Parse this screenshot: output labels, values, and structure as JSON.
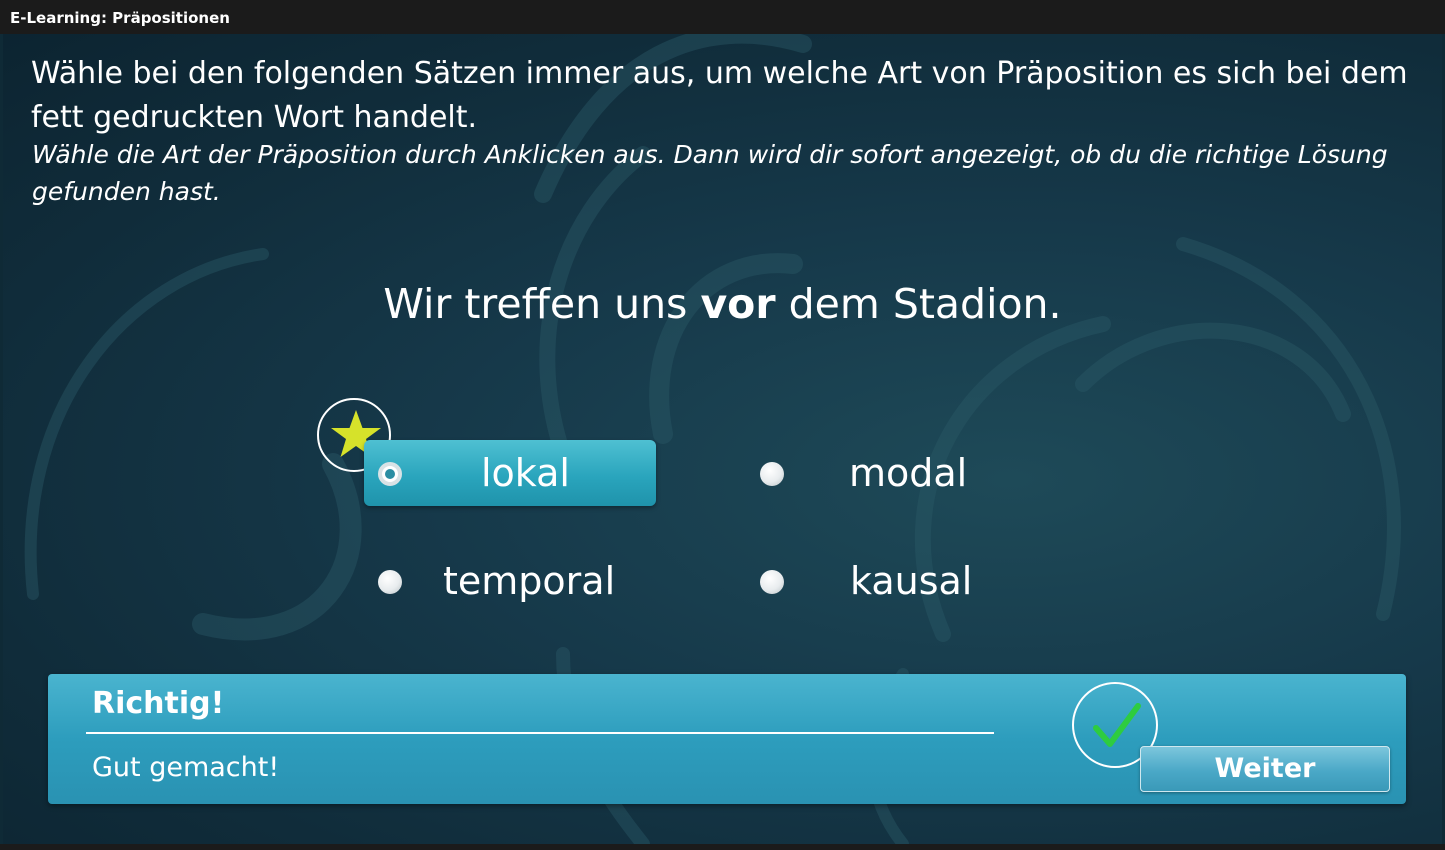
{
  "window": {
    "title": "E-Learning: Präpositionen"
  },
  "instructions": {
    "main": "Wähle bei den folgenden Sätzen immer aus, um welche Art von Präposition es sich bei dem fett gedruckten Wort handelt.",
    "hint": "Wähle die Art der Präposition durch Anklicken aus. Dann wird dir sofort angezeigt, ob du die richtige Lösung gefunden hast."
  },
  "question": {
    "before": "Wir treffen uns ",
    "highlight": "vor",
    "after": " dem Stadion."
  },
  "options": [
    {
      "label": "lokal",
      "selected": true
    },
    {
      "label": "modal",
      "selected": false
    },
    {
      "label": "temporal",
      "selected": false
    },
    {
      "label": "kausal",
      "selected": false
    }
  ],
  "feedback": {
    "title": "Richtig!",
    "message": "Gut gemacht!",
    "next_label": "Weiter"
  },
  "icons": {
    "selected_badge": "star-icon",
    "result_badge": "checkmark-icon"
  },
  "colors": {
    "accent": "#2aa5bd",
    "star": "#d6e22a",
    "check": "#2ecc40"
  }
}
